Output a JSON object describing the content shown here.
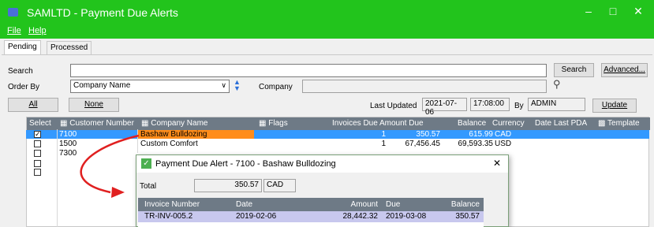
{
  "window": {
    "title": "SAMLTD - Payment Due Alerts",
    "minimize": "–",
    "maximize": "□",
    "close": "✕"
  },
  "menu": {
    "file": "File",
    "help": "Help"
  },
  "tabs": [
    {
      "label": "Pending"
    },
    {
      "label": "Processed"
    }
  ],
  "filters": {
    "search_label": "Search",
    "search_value": "",
    "search_button": "Search",
    "advanced_button": "Advanced...",
    "order_by_label": "Order By",
    "order_by_value": "Company Name",
    "company_label": "Company",
    "company_value": "",
    "all_button": "All",
    "none_button": "None",
    "last_updated_label": "Last Updated",
    "last_updated_date": "2021-07-06",
    "last_updated_time": "17:08:00",
    "by_label": "By",
    "by_value": "ADMIN",
    "update_button": "Update"
  },
  "table": {
    "columns": [
      "Select",
      "Customer Number",
      "Company Name",
      "Flags",
      "Invoices Due",
      "Amount Due",
      "Balance",
      "Currency",
      "Date Last PDA",
      "Template"
    ],
    "rows": [
      {
        "selected": true,
        "customer": "7100",
        "company": "Bashaw Bulldozing",
        "invoices": "1",
        "amount": "350.57",
        "balance": "615.99",
        "currency": "CAD"
      },
      {
        "selected": false,
        "customer": "1500",
        "company": "Custom Comfort",
        "invoices": "1",
        "amount": "67,456.45",
        "balance": "69,593.35",
        "currency": "USD"
      },
      {
        "selected": false,
        "customer": "7300",
        "company": "",
        "invoices": "",
        "amount": "",
        "balance": "",
        "currency": ""
      }
    ]
  },
  "dialog": {
    "title": "Payment Due Alert - 7100 - Bashaw Bulldozing",
    "close": "✕",
    "total_label": "Total",
    "total_value": "350.57",
    "total_currency": "CAD",
    "columns": [
      "Invoice Number",
      "Date",
      "Amount",
      "Due",
      "Balance"
    ],
    "row": {
      "invoice": "TR-INV-005.2",
      "date": "2019-02-06",
      "amount": "28,442.32",
      "due": "2019-03-08",
      "balance": "350.57"
    }
  },
  "colors": {
    "titlebar": "#22c41c",
    "header": "#6e7a86",
    "selection": "#3399ff",
    "highlight": "#ff8c1a",
    "arrow": "#e02020"
  }
}
